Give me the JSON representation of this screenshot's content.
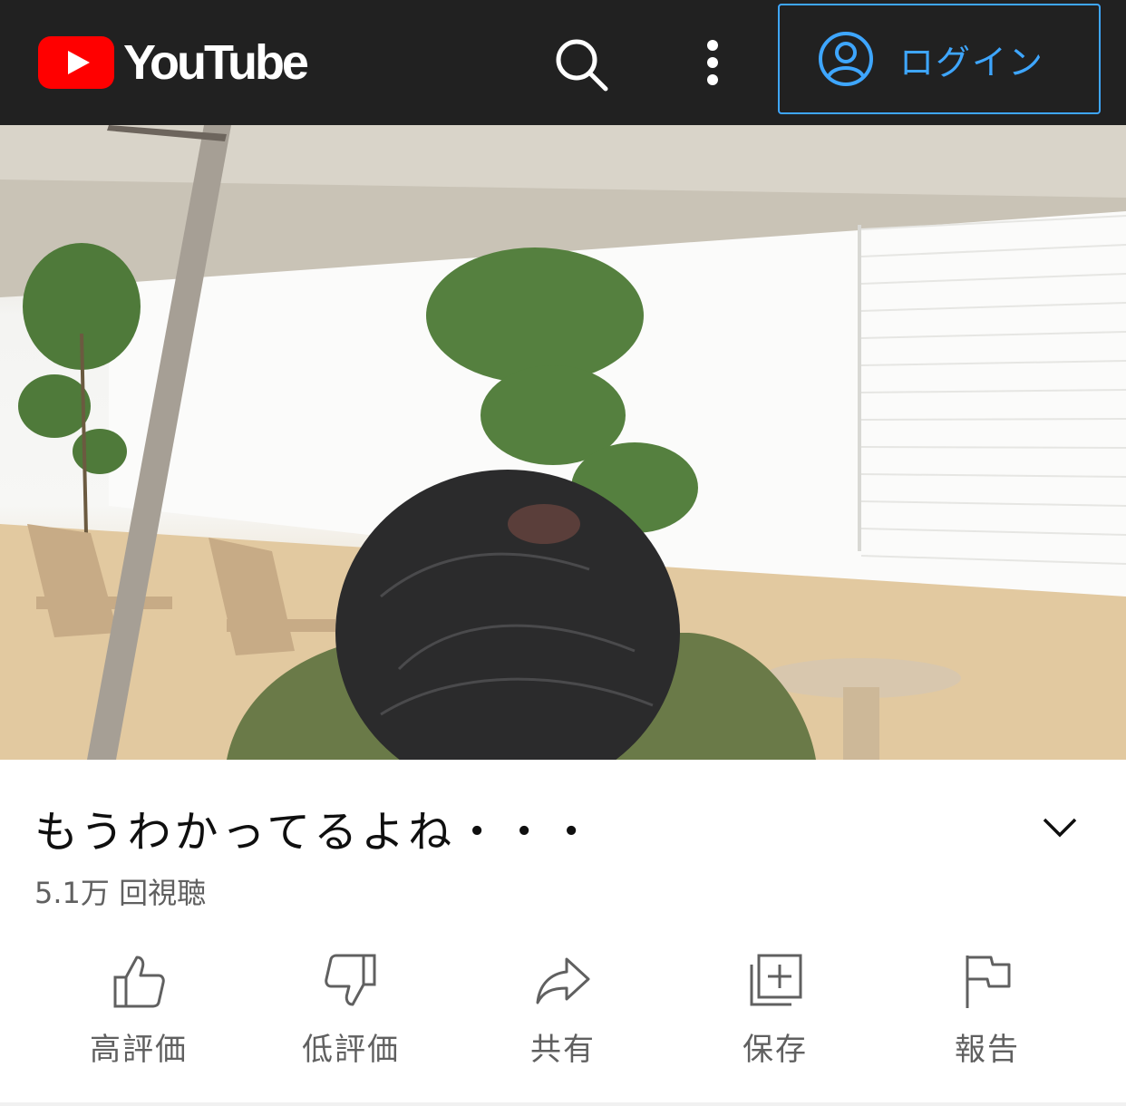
{
  "header": {
    "logo_text": "YouTube",
    "login_label": "ログイン",
    "icons": [
      "search-icon",
      "more-vert-icon",
      "account-circle-icon"
    ]
  },
  "video": {
    "title": "もうわかってるよね・・・",
    "views": "5.1万 回視聴"
  },
  "actions": [
    {
      "label": "高評価",
      "icon": "thumb-up-icon"
    },
    {
      "label": "低評価",
      "icon": "thumb-down-icon"
    },
    {
      "label": "共有",
      "icon": "share-icon"
    },
    {
      "label": "保存",
      "icon": "playlist-add-icon"
    },
    {
      "label": "報告",
      "icon": "flag-icon"
    }
  ],
  "colors": {
    "topbar": "#212121",
    "accent": "#3ea6ff",
    "brand": "#ff0000",
    "secondary_text": "#606060"
  }
}
